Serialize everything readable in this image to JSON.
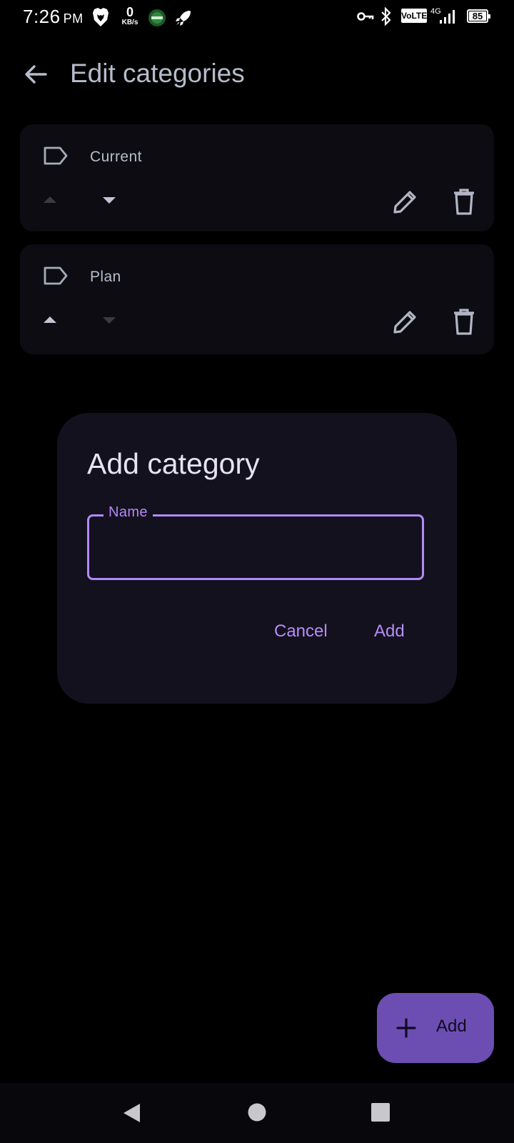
{
  "status_bar": {
    "time": "7:26",
    "ampm": "PM",
    "net_speed_value": "0",
    "net_speed_unit": "KB/s",
    "battery": "85",
    "volte": "VoLTE",
    "network_type": "4G",
    "icons": [
      "brave-lion-icon",
      "app-badge-icon",
      "rocket-icon",
      "vpn-key-icon",
      "bluetooth-icon",
      "volte-icon",
      "signal-icon",
      "battery-icon"
    ]
  },
  "header": {
    "title": "Edit categories",
    "back_icon": "arrow-left-icon"
  },
  "categories": [
    {
      "name": "Current",
      "icon": "label-outline-icon"
    },
    {
      "name": "Plan",
      "icon": "label-outline-icon"
    }
  ],
  "dialog": {
    "title": "Add category",
    "field_label": "Name",
    "field_value": "",
    "cancel_label": "Cancel",
    "confirm_label": "Add"
  },
  "fab": {
    "label": "Add",
    "icon": "plus-icon"
  },
  "nav_bar": {
    "icons": [
      "back-triangle-icon",
      "home-circle-icon",
      "recents-square-icon"
    ]
  },
  "colors": {
    "background": "#000000",
    "card": "#0c0c12",
    "dialog": "#13111e",
    "accent": "#b38af5",
    "fab": "#6c4eb3",
    "title_text": "#b7bccb"
  }
}
